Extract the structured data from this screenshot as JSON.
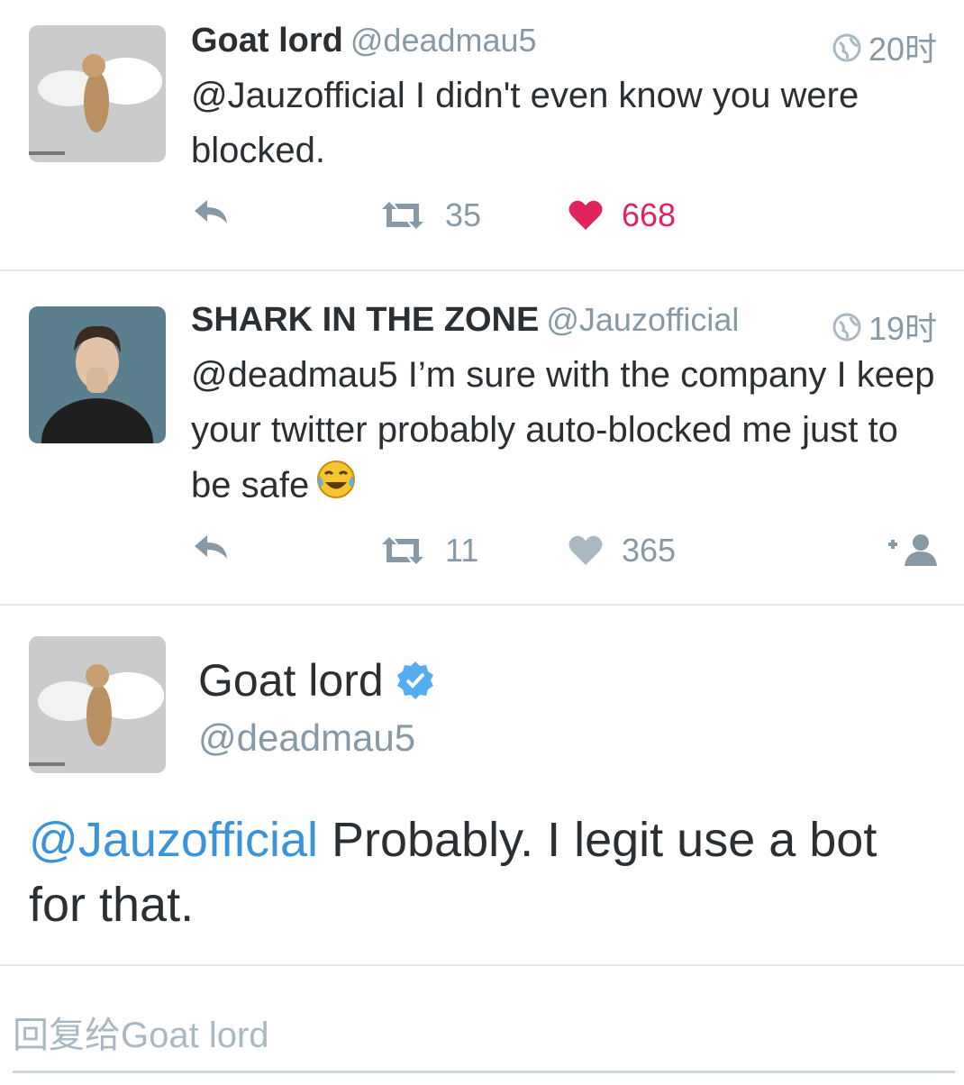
{
  "tweets": [
    {
      "name": "Goat lord",
      "handle": "@deadmau5",
      "time": "20时",
      "text": "@Jauzofficial I didn't even know you were blocked.",
      "retweets": "35",
      "likes": "668",
      "liked": true
    },
    {
      "name": "SHARK IN THE ZONE",
      "handle": "@Jauzofficial",
      "time": "19时",
      "text": "@deadmau5 I’m sure with the company I keep your twitter probably auto-blocked me just to be safe",
      "emoji": "tears-of-joy-emoji",
      "retweets": "11",
      "likes": "365",
      "liked": false
    }
  ],
  "focused": {
    "name": "Goat lord",
    "verified": true,
    "handle": "@deadmau5",
    "mention": "@Jauzofficial",
    "text": " Probably. I legit use a bot for that."
  },
  "reply": {
    "placeholder": "回复给Goat lord"
  },
  "colors": {
    "like_active": "#e0245e",
    "muted": "#8899a6",
    "link": "#3b94d9",
    "verified": "#55acee"
  }
}
